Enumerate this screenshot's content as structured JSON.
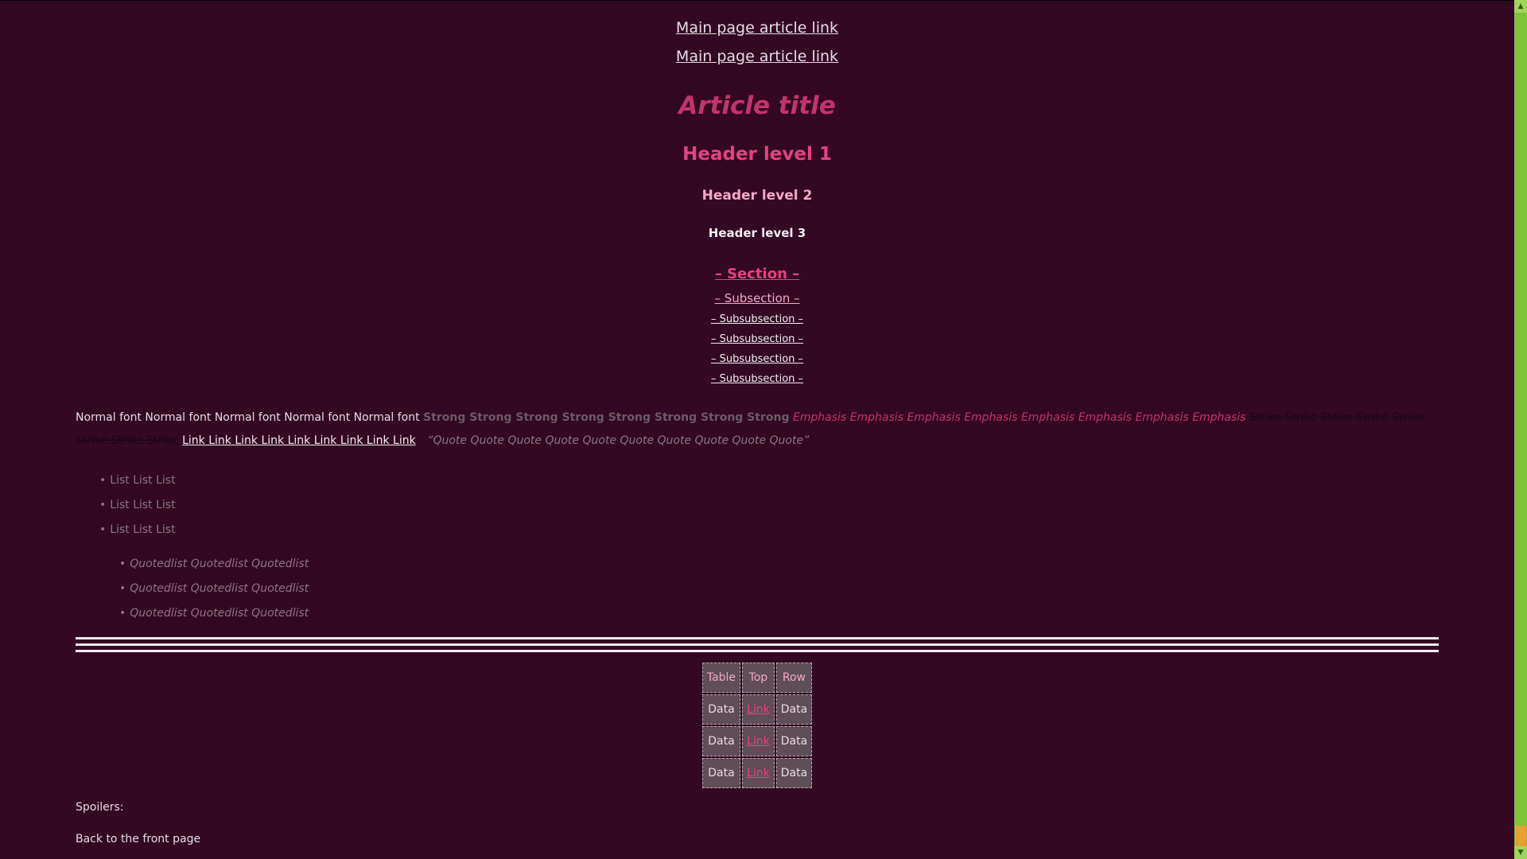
{
  "nav": {
    "main_links": [
      "Main page article link",
      "Main page article link"
    ]
  },
  "article": {
    "title": "Article title",
    "h1": "Header level 1",
    "h2": "Header level 2",
    "h3": "Header level 3",
    "section": "– Section –",
    "subsection": "– Subsection –",
    "subsubsections": [
      "– Subsubsection –",
      "– Subsubsection –",
      "– Subsubsection –",
      "– Subsubsection –"
    ]
  },
  "paragraph": {
    "normal": "Normal font Normal font Normal font Normal font Normal font",
    "strong": "Strong Strong Strong Strong Strong Strong Strong Strong",
    "emphasis": "Emphasis Emphasis Emphasis Emphasis Emphasis Emphasis Emphasis Emphasis",
    "strike": "Strike Strike Strike Strike Strike Strike Strike Strike",
    "link": "Link Link Link Link Link Link Link Link Link",
    "quote": "“Quote Quote Quote Quote Quote Quote Quote Quote Quote Quote”"
  },
  "list": [
    "List List List",
    "List List List",
    "List List List"
  ],
  "quotedlist": [
    "Quotedlist Quotedlist Quotedlist",
    "Quotedlist Quotedlist Quotedlist",
    "Quotedlist Quotedlist Quotedlist"
  ],
  "table": {
    "headers": [
      "Table",
      "Top",
      "Row"
    ],
    "rows": [
      [
        "Data",
        "Link",
        "Data"
      ],
      [
        "Data",
        "Link",
        "Data"
      ],
      [
        "Data",
        "Link",
        "Data"
      ]
    ]
  },
  "footer": {
    "spoilers": "Spoilers:",
    "back": "Back to the front page"
  },
  "colors": {
    "background": "#340722",
    "accent": "#e3437f",
    "title": "#c2336f",
    "scrollbar": "#7ec43a",
    "scroll_thumb": "#e8a030"
  },
  "icons": {
    "scroll_up": "arrow-up-icon",
    "scroll_down": "arrow-down-icon"
  }
}
